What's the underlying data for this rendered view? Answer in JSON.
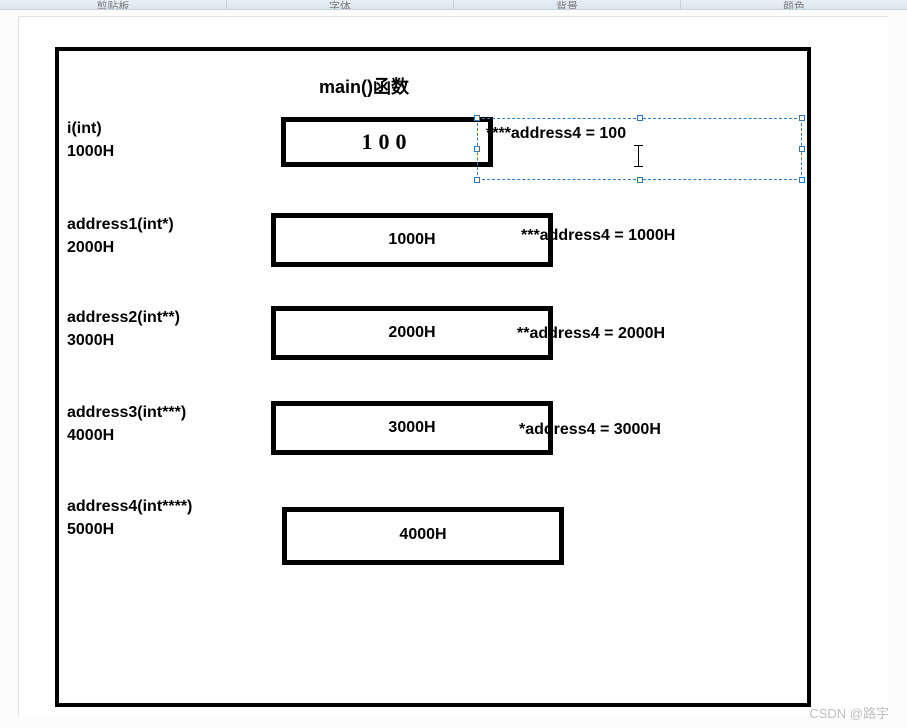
{
  "ribbon": {
    "group1": "剪贴板",
    "group2": "字体",
    "group3": "背景",
    "group4": "颜色"
  },
  "diagram": {
    "title": "main()函数",
    "rows": [
      {
        "name": "i(int)",
        "addr": "1000H",
        "box": "100",
        "expr": "****address4 = 100"
      },
      {
        "name": "address1(int*)",
        "addr": "2000H",
        "box": "1000H",
        "expr": "***address4 = 1000H"
      },
      {
        "name": "address2(int**)",
        "addr": "3000H",
        "box": "2000H",
        "expr": "**address4 = 2000H"
      },
      {
        "name": "address3(int***)",
        "addr": "4000H",
        "box": "3000H",
        "expr": "*address4 = 3000H"
      },
      {
        "name": "address4(int****)",
        "addr": "5000H",
        "box": "4000H",
        "expr": ""
      }
    ]
  },
  "watermark": "CSDN @路宇"
}
